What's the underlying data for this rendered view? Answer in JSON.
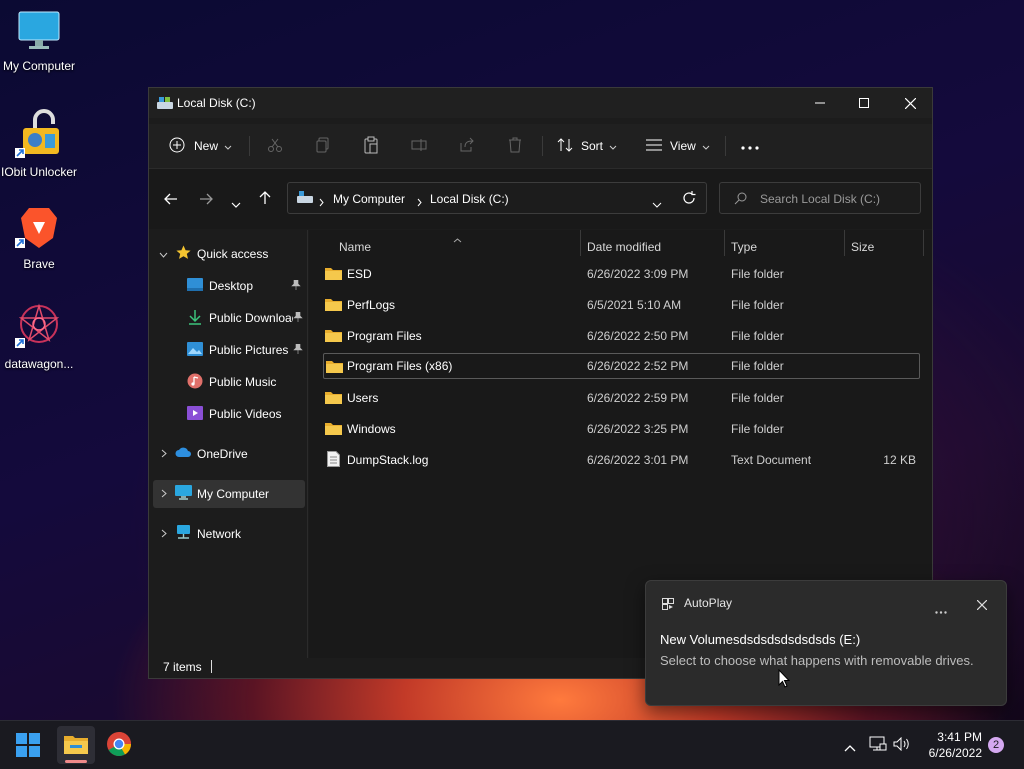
{
  "desktop": {
    "icons": [
      {
        "label": "My Computer"
      },
      {
        "label": "IObit Unlocker"
      },
      {
        "label": "Brave"
      },
      {
        "label": "datawagon..."
      }
    ]
  },
  "window": {
    "title": "Local Disk (C:)",
    "toolbar": {
      "new_label": "New",
      "sort_label": "Sort",
      "view_label": "View"
    },
    "address": {
      "crumbs": [
        "My Computer",
        "Local Disk (C:)"
      ]
    },
    "search": {
      "placeholder": "Search Local Disk (C:)"
    },
    "sidebar": {
      "quick_access": "Quick access",
      "pinned": [
        {
          "label": "Desktop"
        },
        {
          "label": "Public Downloads"
        },
        {
          "label": "Public Pictures"
        },
        {
          "label": "Public Music"
        },
        {
          "label": "Public Videos"
        }
      ],
      "onedrive": "OneDrive",
      "my_computer": "My Computer",
      "network": "Network"
    },
    "columns": {
      "name": "Name",
      "date": "Date modified",
      "type": "Type",
      "size": "Size"
    },
    "files": [
      {
        "name": "ESD",
        "date": "6/26/2022 3:09 PM",
        "type": "File folder",
        "size": ""
      },
      {
        "name": "PerfLogs",
        "date": "6/5/2021 5:10 AM",
        "type": "File folder",
        "size": ""
      },
      {
        "name": "Program Files",
        "date": "6/26/2022 2:50 PM",
        "type": "File folder",
        "size": ""
      },
      {
        "name": "Program Files (x86)",
        "date": "6/26/2022 2:52 PM",
        "type": "File folder",
        "size": ""
      },
      {
        "name": "Users",
        "date": "6/26/2022 2:59 PM",
        "type": "File folder",
        "size": ""
      },
      {
        "name": "Windows",
        "date": "6/26/2022 3:25 PM",
        "type": "File folder",
        "size": ""
      },
      {
        "name": "DumpStack.log",
        "date": "6/26/2022 3:01 PM",
        "type": "Text Document",
        "size": "12 KB"
      }
    ],
    "status": {
      "items": "7 items"
    }
  },
  "toast": {
    "app": "AutoPlay",
    "title": "New Volumesdsdsdsdsdsdsds (E:)",
    "body": "Select to choose what happens with removable drives."
  },
  "taskbar": {
    "time": "3:41 PM",
    "date": "6/26/2022",
    "notification_count": "2"
  },
  "colors": {
    "accent": "#0078d4",
    "folder": "#f2c14e",
    "selected_row_border": "#5a5a5a"
  }
}
